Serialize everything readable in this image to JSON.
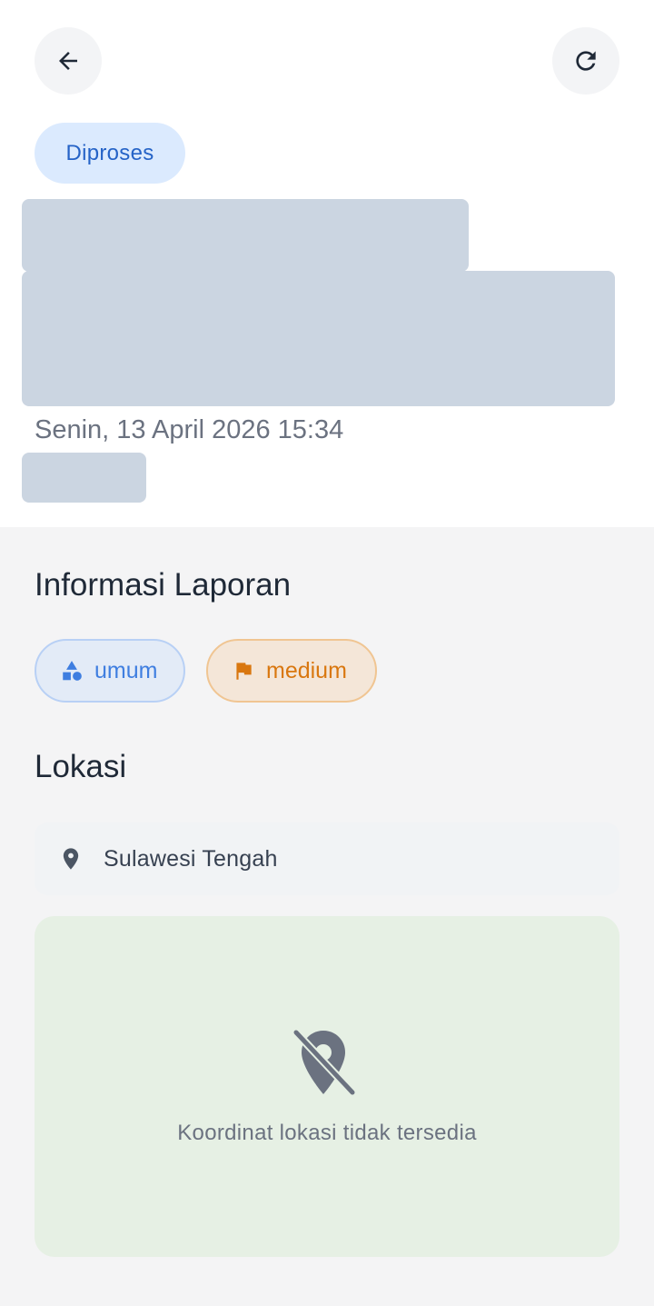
{
  "header": {
    "back_icon": "arrow-left-icon",
    "refresh_icon": "refresh-icon"
  },
  "report": {
    "status": "Diproses",
    "date": "Senin, 13 April 2026 15:34"
  },
  "info_section": {
    "title": "Informasi Laporan",
    "category": {
      "label": "umum",
      "icon": "category-shapes-icon",
      "color": "#3f7ee0"
    },
    "priority": {
      "label": "medium",
      "icon": "flag-icon",
      "color": "#d9770f"
    }
  },
  "location_section": {
    "title": "Lokasi",
    "address": "Sulawesi Tengah",
    "address_icon": "location-pin-icon",
    "map_empty_icon": "location-off-icon",
    "map_empty_text": "Koordinat lokasi tidak tersedia"
  },
  "colors": {
    "status_bg": "#dbeafe",
    "status_text": "#2563c7",
    "skeleton": "#cbd5e1",
    "map_bg": "#e6f0e4"
  }
}
